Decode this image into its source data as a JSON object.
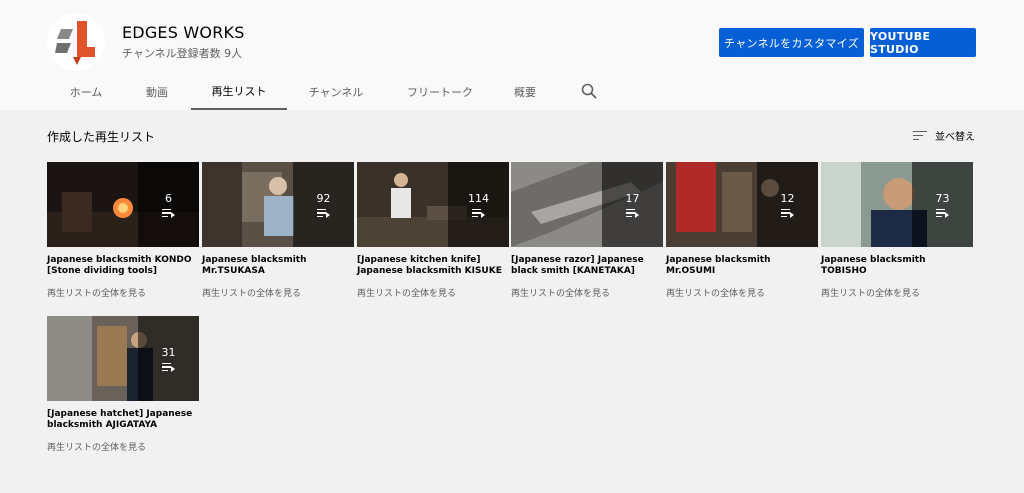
{
  "channel": {
    "name": "EDGES WORKS",
    "subscribers": "チャンネル登録者数 9人"
  },
  "buttons": {
    "customize": "チャンネルをカスタマイズ",
    "studio": "YOUTUBE STUDIO"
  },
  "tabs": [
    {
      "label": "ホーム"
    },
    {
      "label": "動画"
    },
    {
      "label": "再生リスト",
      "active": true
    },
    {
      "label": "チャンネル"
    },
    {
      "label": "フリートーク"
    },
    {
      "label": "概要"
    }
  ],
  "section": {
    "title": "作成した再生リスト",
    "sort_label": "並べ替え"
  },
  "playlists": [
    {
      "count": "6",
      "title": "Japanese blacksmith KONDO [Stone dividing tools]",
      "link": "再生リストの全体を見る",
      "thumb": "forge"
    },
    {
      "count": "92",
      "title": "Japanese blacksmith Mr.TSUKASA",
      "link": "再生リストの全体を見る",
      "thumb": "workshop"
    },
    {
      "count": "114",
      "title": "[Japanese kitchen knife] Japanese blacksmith KISUKE",
      "link": "再生リストの全体を見る",
      "thumb": "office"
    },
    {
      "count": "17",
      "title": "[Japanese razor] Japanese black smith [KANETAKA]",
      "link": "再生リストの全体を見る",
      "thumb": "razor"
    },
    {
      "count": "12",
      "title": "Japanese blacksmith Mr.OSUMI",
      "link": "再生リストの全体を見る",
      "thumb": "red"
    },
    {
      "count": "73",
      "title": "Japanese blacksmith TOBISHO",
      "link": "再生リストの全体を見る",
      "thumb": "man"
    },
    {
      "count": "31",
      "title": "[Japanese hatchet] Japanese blacksmith AJIGATAYA",
      "link": "再生リストの全体を見る",
      "thumb": "shop"
    }
  ]
}
